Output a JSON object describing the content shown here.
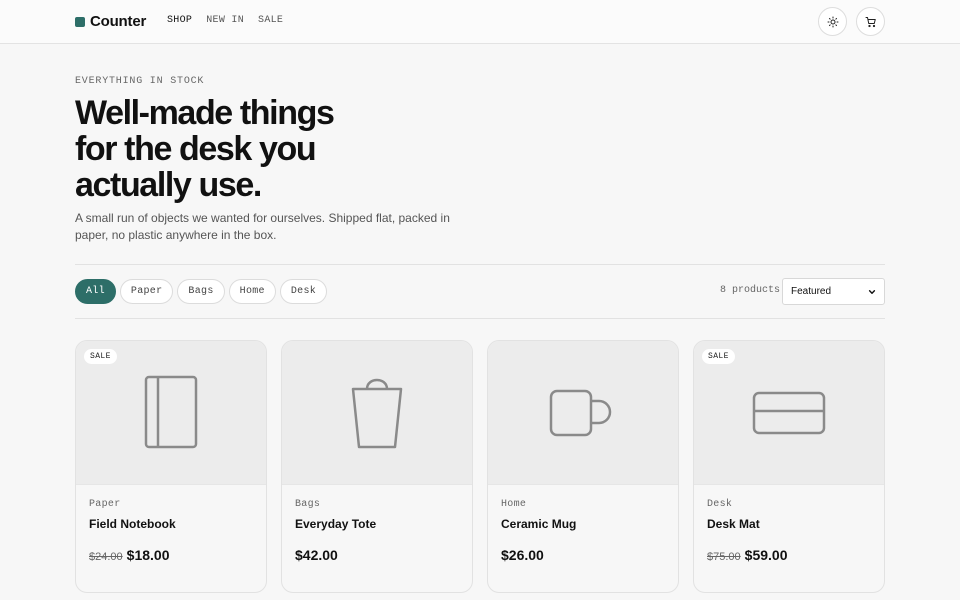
{
  "brand": {
    "name": "Counter",
    "accent": "#2d6e68"
  },
  "nav": [
    {
      "label": "SHOP",
      "active": true
    },
    {
      "label": "NEW IN",
      "active": false
    },
    {
      "label": "SALE",
      "active": false
    }
  ],
  "header_actions": {
    "theme_icon": "sun-icon",
    "cart_icon": "cart-icon"
  },
  "hero": {
    "eyebrow": "EVERYTHING IN STOCK",
    "title": "Well-made things for the desk you actually use.",
    "lede": "A small run of objects we wanted for ourselves. Shipped flat, packed in paper, no plastic anywhere in the box."
  },
  "filters": {
    "chips": [
      "All",
      "Paper",
      "Bags",
      "Home",
      "Desk"
    ],
    "active": "All",
    "count_label": "8 products",
    "sort_value": "Featured"
  },
  "products": [
    {
      "badge": "SALE",
      "category": "Paper",
      "name": "Field Notebook",
      "old_price": "$24.00",
      "price": "$18.00",
      "icon": "notebook-icon"
    },
    {
      "badge": "",
      "category": "Bags",
      "name": "Everyday Tote",
      "old_price": "",
      "price": "$42.00",
      "icon": "tote-bag-icon"
    },
    {
      "badge": "",
      "category": "Home",
      "name": "Ceramic Mug",
      "old_price": "",
      "price": "$26.00",
      "icon": "mug-icon"
    },
    {
      "badge": "SALE",
      "category": "Desk",
      "name": "Desk Mat",
      "old_price": "$75.00",
      "price": "$59.00",
      "icon": "desk-mat-icon"
    }
  ]
}
